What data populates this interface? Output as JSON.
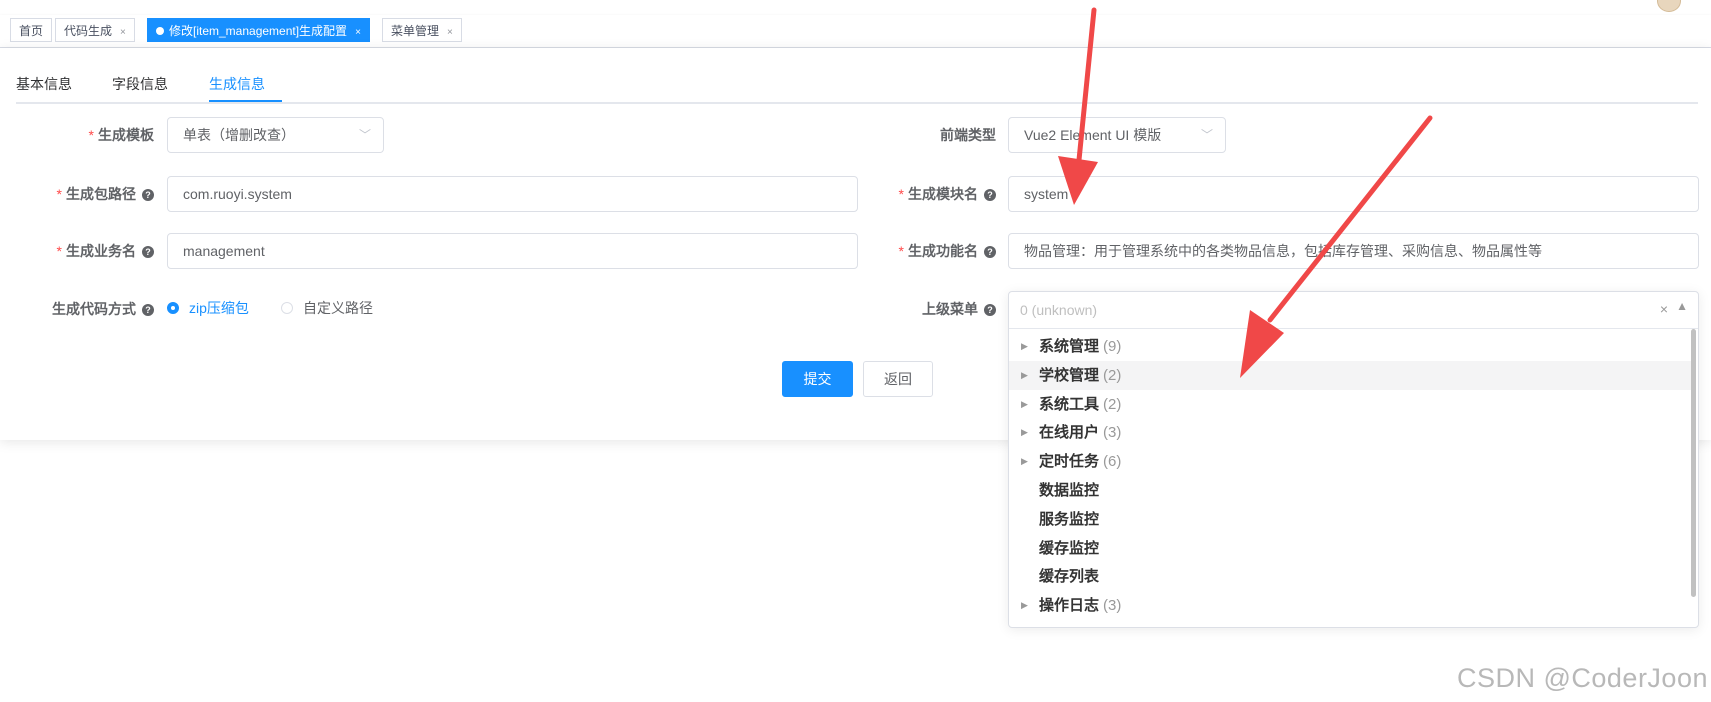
{
  "tags": [
    {
      "label": "首页",
      "closable": false
    },
    {
      "label": "代码生成",
      "closable": true
    },
    {
      "label": "修改[item_management]生成配置",
      "closable": true,
      "active": true
    },
    {
      "label": "菜单管理",
      "closable": true
    }
  ],
  "tabs": [
    "基本信息",
    "字段信息",
    "生成信息"
  ],
  "form": {
    "tpl_label": "生成模板",
    "tpl_value": "单表（增删改查）",
    "frontend_label": "前端类型",
    "frontend_value": "Vue2 Element UI 模版",
    "package_label": "生成包路径",
    "package_value": "com.ruoyi.system",
    "module_label": "生成模块名",
    "module_value": "system",
    "business_label": "生成业务名",
    "business_value": "management",
    "function_label": "生成功能名",
    "function_value": "物品管理：用于管理系统中的各类物品信息，包括库存管理、采购信息、物品属性等",
    "gentype_label": "生成代码方式",
    "gentype_options": [
      "zip压缩包",
      "自定义路径"
    ],
    "gentype_selected": "zip压缩包",
    "parent_label": "上级菜单",
    "parent_placeholder": "0 (unknown)",
    "clear_icon": "×"
  },
  "menu_options": [
    {
      "name": "系统管理",
      "count": "(9)",
      "expandable": true
    },
    {
      "name": "学校管理",
      "count": "(2)",
      "expandable": true,
      "highlighted": true
    },
    {
      "name": "系统工具",
      "count": "(2)",
      "expandable": true
    },
    {
      "name": "在线用户",
      "count": "(3)",
      "expandable": true
    },
    {
      "name": "定时任务",
      "count": "(6)",
      "expandable": true
    },
    {
      "name": "数据监控",
      "count": "",
      "expandable": false
    },
    {
      "name": "服务监控",
      "count": "",
      "expandable": false
    },
    {
      "name": "缓存监控",
      "count": "",
      "expandable": false
    },
    {
      "name": "缓存列表",
      "count": "",
      "expandable": false
    },
    {
      "name": "操作日志",
      "count": "(3)",
      "expandable": true
    }
  ],
  "buttons": {
    "submit": "提交",
    "back": "返回"
  },
  "watermark": "CSDN @CoderJoon",
  "colors": {
    "primary": "#1890ff",
    "required": "#ff4949",
    "arrow": "#f04848"
  },
  "icons": {
    "tag_close": "close-icon",
    "question": "question-circle-icon",
    "dropdown": "chevron-down-icon",
    "tree_expand": "caret-right-icon"
  }
}
